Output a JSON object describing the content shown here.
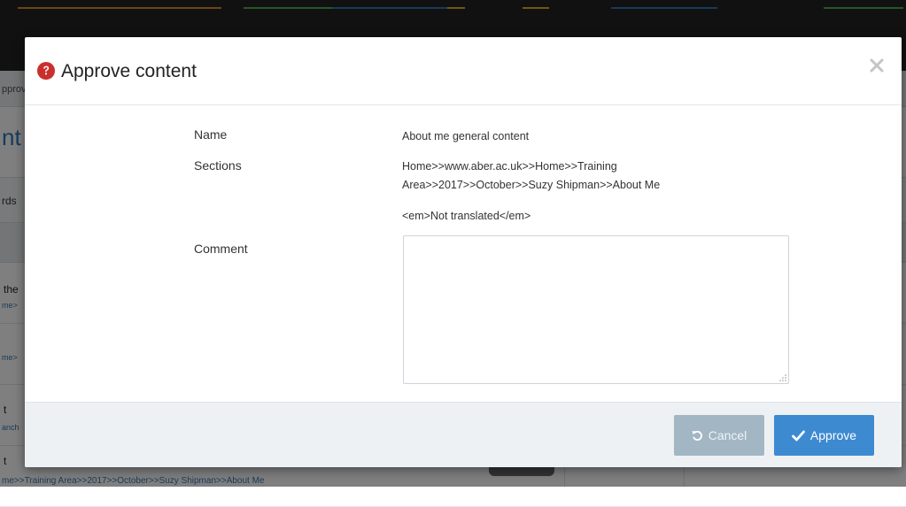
{
  "background": {
    "breadcrumb_fragment": "pprov",
    "heading_fragment": "nt",
    "toolbar_fragment": "rds",
    "rows": [
      {
        "title": "the",
        "link": "me>"
      },
      {
        "title": "",
        "link": "me>"
      },
      {
        "title": "t",
        "link": "anch"
      },
      {
        "title": "t",
        "link": ""
      }
    ],
    "footer_link": "me>>Training Area>>2017>>October>>Suzy Shipman>>About Me"
  },
  "modal": {
    "title": "Approve content",
    "help_icon": "question-circle-icon",
    "close_icon": "close-icon",
    "fields": {
      "name_label": "Name",
      "name_value": "About me general content",
      "sections_label": "Sections",
      "sections_value_line1": "Home>>www.aber.ac.uk>>Home>>Training",
      "sections_value_line2": "Area>>2017>>October>>Suzy Shipman>>About Me",
      "translation_note": "<em>Not translated</em>",
      "comment_label": "Comment",
      "comment_value": ""
    },
    "buttons": {
      "cancel_label": "Cancel",
      "cancel_icon": "undo-icon",
      "approve_label": "Approve",
      "approve_icon": "check-icon"
    }
  },
  "colors": {
    "accent": "#3d8ad1",
    "help_icon": "#c9302c",
    "cancel_button": "#a3b6c4",
    "link": "#2f77b6"
  }
}
